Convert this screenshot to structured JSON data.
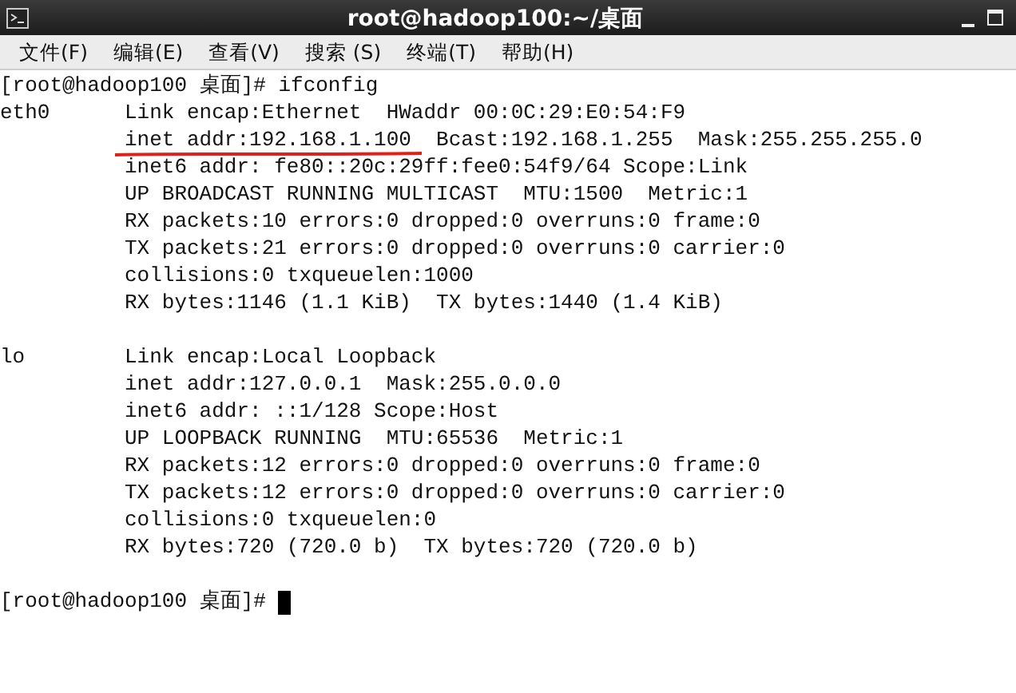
{
  "window": {
    "title": "root@hadoop100:~/桌面"
  },
  "menu": [
    "文件(F)",
    "编辑(E)",
    "查看(V)",
    "搜索 (S)",
    "终端(T)",
    "帮助(H)"
  ],
  "terminal": {
    "lines": [
      {
        "kind": "prompt",
        "text": "[root@hadoop100 桌面]# ifconfig",
        "cursor": false
      },
      {
        "kind": "output",
        "label": "eth0",
        "text": "Link encap:Ethernet  HWaddr 00:0C:29:E0:54:F9"
      },
      {
        "kind": "output",
        "text": "inet addr:192.168.1.100  Bcast:192.168.1.255  Mask:255.255.255.0"
      },
      {
        "kind": "output",
        "text": "inet6 addr: fe80::20c:29ff:fee0:54f9/64 Scope:Link"
      },
      {
        "kind": "output",
        "text": "UP BROADCAST RUNNING MULTICAST  MTU:1500  Metric:1"
      },
      {
        "kind": "output",
        "text": "RX packets:10 errors:0 dropped:0 overruns:0 frame:0"
      },
      {
        "kind": "output",
        "text": "TX packets:21 errors:0 dropped:0 overruns:0 carrier:0"
      },
      {
        "kind": "output",
        "text": "collisions:0 txqueuelen:1000"
      },
      {
        "kind": "output",
        "text": "RX bytes:1146 (1.1 KiB)  TX bytes:1440 (1.4 KiB)"
      },
      {
        "kind": "blank"
      },
      {
        "kind": "output",
        "label": "lo",
        "text": "Link encap:Local Loopback"
      },
      {
        "kind": "output",
        "text": "inet addr:127.0.0.1  Mask:255.0.0.0"
      },
      {
        "kind": "output",
        "text": "inet6 addr: ::1/128 Scope:Host"
      },
      {
        "kind": "output",
        "text": "UP LOOPBACK RUNNING  MTU:65536  Metric:1"
      },
      {
        "kind": "output",
        "text": "RX packets:12 errors:0 dropped:0 overruns:0 frame:0"
      },
      {
        "kind": "output",
        "text": "TX packets:12 errors:0 dropped:0 overruns:0 carrier:0"
      },
      {
        "kind": "output",
        "text": "collisions:0 txqueuelen:0"
      },
      {
        "kind": "output",
        "text": "RX bytes:720 (720.0 b)  TX bytes:720 (720.0 b)"
      },
      {
        "kind": "blank"
      },
      {
        "kind": "prompt",
        "text": "[root@hadoop100 桌面]#",
        "cursor": true
      }
    ]
  }
}
